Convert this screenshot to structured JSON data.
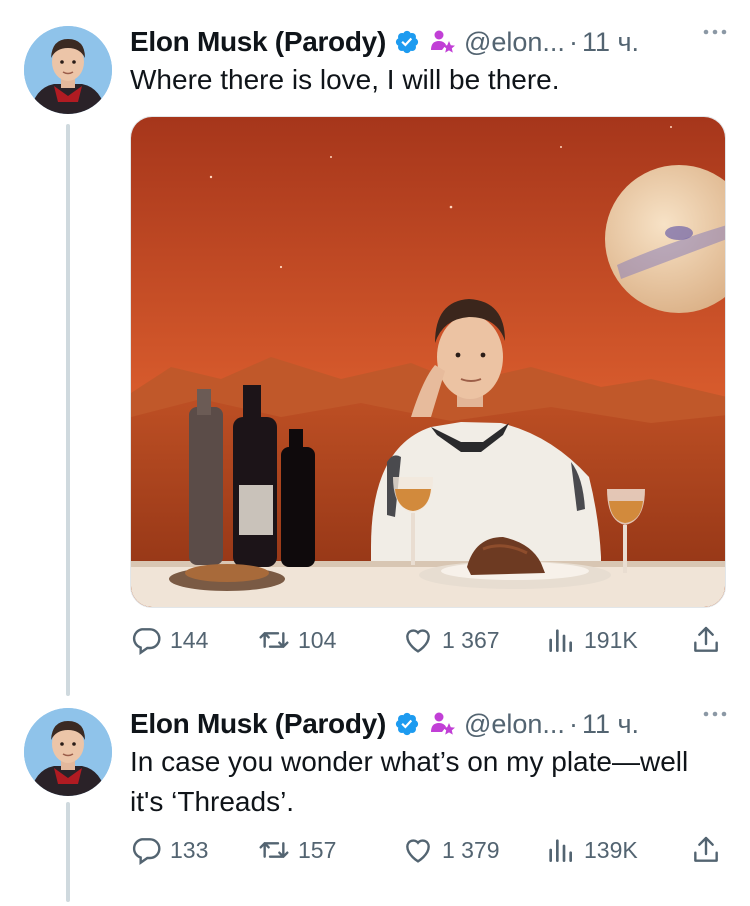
{
  "tweets": [
    {
      "author": {
        "name": "Elon Musk (Parody)",
        "handle": "@elon...",
        "separator": "·",
        "time": "11 ч."
      },
      "text": "Where there is love, I will be there.",
      "has_media": true,
      "stats": {
        "replies": "144",
        "reposts": "104",
        "likes": "1 367",
        "views": "191K"
      }
    },
    {
      "author": {
        "name": "Elon Musk (Parody)",
        "handle": "@elon...",
        "separator": "·",
        "time": "11 ч."
      },
      "text": "In case you wonder what’s on my plate—well it's ‘Threads’.",
      "has_media": false,
      "stats": {
        "replies": "133",
        "reposts": "157",
        "likes": "1 379",
        "views": "139K"
      }
    }
  ],
  "icons": {
    "verified": "verified-badge-icon",
    "parody": "parody-label-icon",
    "more": "more-dots-icon",
    "reply": "reply-icon",
    "repost": "repost-icon",
    "like": "heart-icon",
    "views": "views-bar-chart-icon",
    "share": "share-icon"
  },
  "colors": {
    "verified_blue": "#1d9bf0",
    "parody_purple": "#c13fd6",
    "secondary_text": "#536471",
    "thread_line": "#cfd9de",
    "mars_sky": "#d7642f"
  }
}
